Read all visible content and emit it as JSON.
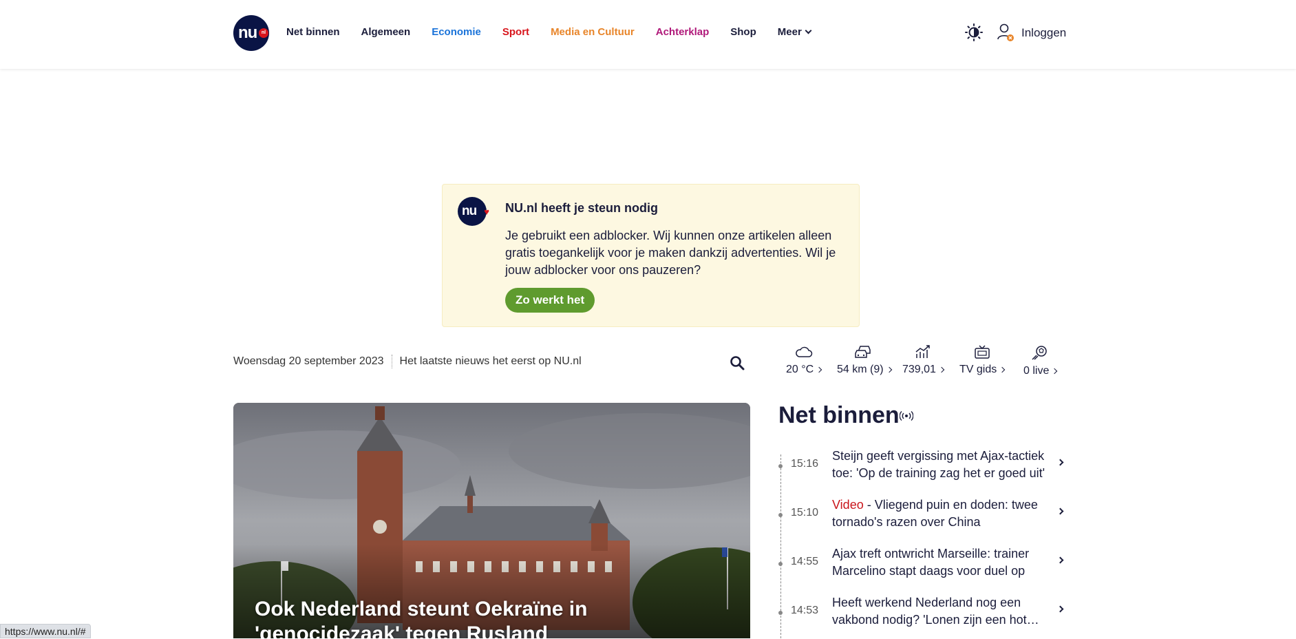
{
  "header": {
    "logo_text": "nu",
    "logo_badge": "nl",
    "nav": [
      {
        "label": "Net binnen",
        "color": "#1b1d3b"
      },
      {
        "label": "Algemeen",
        "color": "#1b1d3b"
      },
      {
        "label": "Economie",
        "color": "#1a73d9"
      },
      {
        "label": "Sport",
        "color": "#d8151c"
      },
      {
        "label": "Media en Cultuur",
        "color": "#e8852a"
      },
      {
        "label": "Achterklap",
        "color": "#b0197a"
      },
      {
        "label": "Shop",
        "color": "#1b1d3b"
      },
      {
        "label": "Meer",
        "color": "#1b1d3b"
      }
    ],
    "login_label": "Inloggen"
  },
  "notice": {
    "title": "NU.nl heeft je steun nodig",
    "text": "Je gebruikt een adblocker. Wij kunnen onze artikelen alleen gratis toegankelijk voor je maken dankzij advertenties. Wil je jouw adblocker voor ons pauzeren?",
    "button_label": "Zo werkt het"
  },
  "date_row": {
    "date": "Woensdag 20 september 2023",
    "tagline": "Het laatste nieuws het eerst op NU.nl"
  },
  "widgets": [
    {
      "icon": "cloud-icon",
      "label": "20 °C"
    },
    {
      "icon": "traffic-icon",
      "label": "54 km (9)"
    },
    {
      "icon": "stock-chart-icon",
      "label": "739,01"
    },
    {
      "icon": "tv-icon",
      "label": "TV gids"
    },
    {
      "icon": "football-live-icon",
      "label": "0 live"
    }
  ],
  "hero": {
    "title": "Ook Nederland steunt Oekraïne in 'genocidezaak' tegen Rusland"
  },
  "net_binnen": {
    "heading": "Net binnen",
    "items": [
      {
        "time": "15:16",
        "prefix": "",
        "text": "Steijn geeft vergissing met Ajax-tactiek toe: 'Op de training zag het er goed uit'"
      },
      {
        "time": "15:10",
        "prefix": "Video",
        "text": "Vliegend puin en doden: twee tornado's razen over China"
      },
      {
        "time": "14:55",
        "prefix": "",
        "text": "Ajax treft ontwricht Marseille: trainer Marcelino stapt daags voor duel op"
      },
      {
        "time": "14:53",
        "prefix": "",
        "text": "Heeft werkend Nederland nog een vakbond nodig? 'Lonen zijn een hot…"
      }
    ]
  },
  "status_url": "https://www.nu.nl/#"
}
